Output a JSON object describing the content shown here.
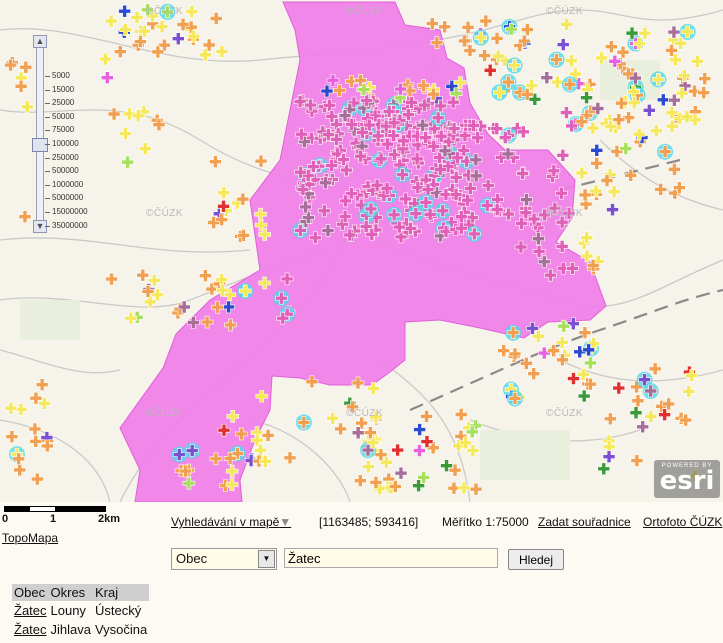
{
  "map": {
    "watermark": "©ČÚZK",
    "scale_labels": [
      "5000",
      "15000",
      "25000",
      "50000",
      "75000",
      "100000",
      "250000",
      "500000",
      "1000000",
      "5000000",
      "15000000",
      "35000000"
    ],
    "selected_scale_index": 5,
    "esri_powered": "POWERED BY",
    "esri_logo": "esri",
    "polygon_color": "#f07ee8",
    "marker_colors": [
      "#f0a050",
      "#f5e85a",
      "#e860e0",
      "#a7e05a",
      "#3a9a3a",
      "#7a50d0",
      "#2a4ad0",
      "#e03030",
      "#a86e9a"
    ]
  },
  "scalebar": {
    "zero": "0",
    "one": "1",
    "two": "2km"
  },
  "toolbar": {
    "search_in_map": "Vyhledávání v mapě",
    "coordinates": "[1163485; 593416]",
    "scale_text": "Měřítko 1:75000",
    "enter_coordinates": "Zadat souřadnice",
    "orthophoto": "Ortofoto ČÚZK"
  },
  "topomapa": "TopoMapa",
  "search": {
    "layer_value": "Obec",
    "query": "Žatec",
    "button": "Hledej"
  },
  "results": {
    "headers": [
      "Obec",
      "Okres",
      "Kraj"
    ],
    "rows": [
      {
        "obec": "Žatec",
        "okres": "Louny",
        "kraj": "Ústecký"
      },
      {
        "obec": "Žatec",
        "okres": "Jihlava",
        "kraj": "Vysočina"
      }
    ]
  }
}
